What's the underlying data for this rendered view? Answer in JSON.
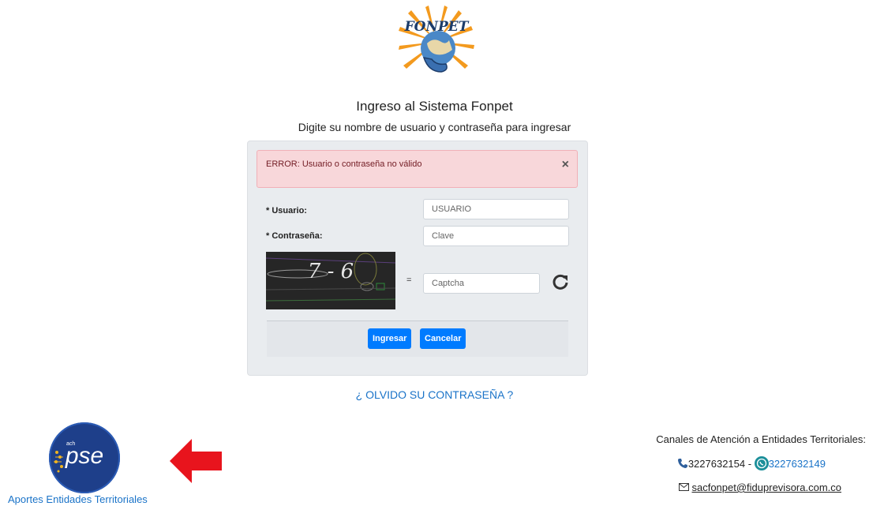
{
  "header": {
    "logo_text": "FONPET",
    "title": "Ingreso al Sistema Fonpet",
    "subtitle": "Digite su nombre de usuario y contraseña para ingresar"
  },
  "alert": {
    "message": "ERROR: Usuario o contraseña no válido",
    "close_label": "×"
  },
  "form": {
    "user_label": "* Usuario:",
    "user_placeholder": "USUARIO",
    "password_label": "* Contraseña:",
    "password_placeholder": "Clave",
    "captcha_text": "7 - 6",
    "equals": "=",
    "captcha_placeholder": "Captcha",
    "submit_label": "Ingresar",
    "cancel_label": "Cancelar"
  },
  "forgot_password": "¿ OLVIDO SU CONTRASEÑA ?",
  "pse": {
    "logo_small": "ach",
    "logo_text": "pse",
    "label": "Aportes Entidades Territoriales"
  },
  "contact": {
    "heading": "Canales de Atención a Entidades Territoriales:",
    "phone": "3227632154",
    "separator": " - ",
    "whatsapp": "3227632149",
    "email": "sacfonpet@fiduprevisora.com.co"
  },
  "colors": {
    "primary": "#007bff",
    "link": "#1a73c8",
    "alert_bg": "#f8d7da",
    "alert_text": "#721c24",
    "arrow": "#e8141d",
    "pse_blue": "#1e3f8a"
  },
  "icons": [
    "fonpet-logo-icon",
    "close-icon",
    "refresh-icon",
    "pse-logo-icon",
    "red-arrow-icon",
    "phone-icon",
    "whatsapp-icon",
    "envelope-icon"
  ]
}
